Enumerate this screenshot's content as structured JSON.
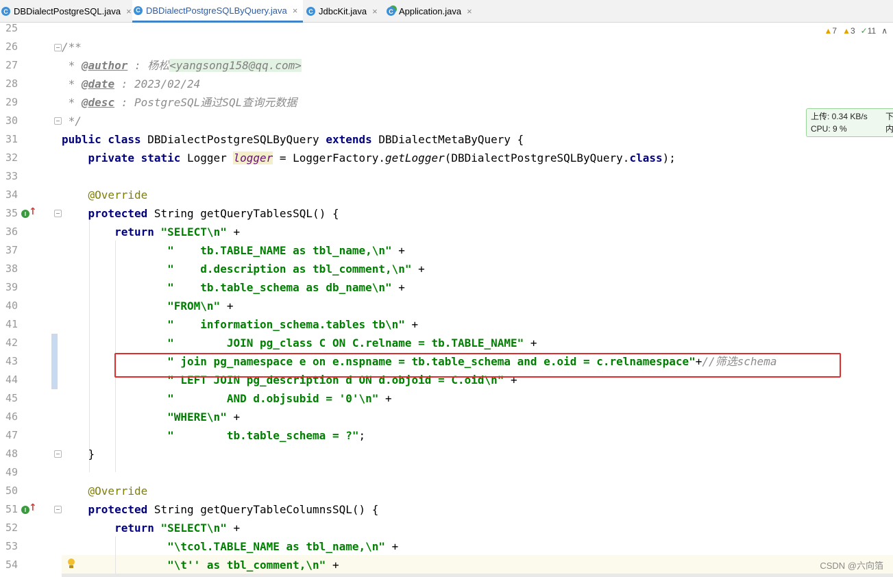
{
  "tabs": [
    {
      "name": "DBDialectPostgreSQL.java",
      "active": false,
      "icon": "class-icon",
      "close": "×"
    },
    {
      "name": "DBDialectPostgreSQLByQuery.java",
      "active": true,
      "icon": "class-icon",
      "close": "×"
    },
    {
      "name": "JdbcKit.java",
      "active": false,
      "icon": "class-icon",
      "close": "×"
    },
    {
      "name": "Application.java",
      "active": false,
      "icon": "runnable-class-icon",
      "close": "×"
    }
  ],
  "inspection": {
    "warnings": "7",
    "weak_warnings": "3",
    "ok": "11"
  },
  "net_widget": {
    "upload": "上传: 0.34 KB/s",
    "cpu": "CPU: 9 %",
    "download_clipped": "下",
    "memory_clipped": "内"
  },
  "line_numbers": [
    "25",
    "26",
    "27",
    "28",
    "29",
    "30",
    "31",
    "32",
    "33",
    "34",
    "35",
    "36",
    "37",
    "38",
    "39",
    "40",
    "41",
    "42",
    "43",
    "44",
    "45",
    "46",
    "47",
    "48",
    "49",
    "50",
    "51",
    "52",
    "53",
    "54"
  ],
  "code": {
    "l26": "/**",
    "l27_star": " * ",
    "l27_tag": "@author",
    "l27_sep": " : 杨松",
    "l27_mail": "<yangsong158@qq.com>",
    "l28_star": " * ",
    "l28_tag": "@date",
    "l28_val": " : 2023/02/24",
    "l29_star": " * ",
    "l29_tag": "@desc",
    "l29_val": " : PostgreSQL通过SQL查询元数据",
    "l30": " */",
    "l31_kw": "public class",
    "l31_a": " DBDialectPostgreSQLByQuery ",
    "l31_kw2": "extends",
    "l31_b": " DBDialectMetaByQuery {",
    "l32_kw": "    private static",
    "l32_a": " Logger ",
    "l32_fld": "logger",
    "l32_b": " = LoggerFactory.",
    "l32_mth": "getLogger",
    "l32_c": "(DBDialectPostgreSQLByQuery.",
    "l32_kw2": "class",
    "l32_d": ");",
    "l34": "    @Override",
    "l35_kw": "    protected",
    "l35_a": " String getQueryTablesSQL() {",
    "l36_kw": "        return",
    "l36_sp": " ",
    "l36_str": "\"SELECT\\n\"",
    "l36_op": " +",
    "l37_str": "                \"    tb.TABLE_NAME as tbl_name,\\n\"",
    "l37_op": " +",
    "l38_str": "                \"    d.description as tbl_comment,\\n\"",
    "l38_op": " +",
    "l39_str": "                \"    tb.table_schema as db_name\\n\"",
    "l39_op": " +",
    "l40_str": "                \"FROM\\n\"",
    "l40_op": " +",
    "l41_str": "                \"    information_schema.tables tb\\n\"",
    "l41_op": " +",
    "l42_str": "                \"        JOIN pg_class C ON C.relname = tb.TABLE_NAME\"",
    "l42_op": " +",
    "l43_str": "                \" join pg_namespace e on e.nspname = tb.table_schema and e.oid = c.relnamespace\"",
    "l43_op": "+",
    "l43_cmt": "//筛选schema",
    "l44_str": "                \" LEFT JOIN pg_description d ON d.objoid = C.oid\\n\"",
    "l44_op": " +",
    "l45_str": "                \"        AND d.objsubid = '0'\\n\"",
    "l45_op": " +",
    "l46_str": "                \"WHERE\\n\"",
    "l46_op": " +",
    "l47_str": "                \"        tb.table_schema = ?\"",
    "l47_op": ";",
    "l48": "    }",
    "l50": "    @Override",
    "l51_kw": "    protected",
    "l51_a": " String getQueryTableColumnsSQL() {",
    "l52_kw": "        return",
    "l52_sp": " ",
    "l52_str": "\"SELECT\\n\"",
    "l52_op": " +",
    "l53_str": "                \"\\tcol.TABLE_NAME as tbl_name,\\n\"",
    "l53_op": " +",
    "l54_str": "                \"\\t'' as tbl_comment,\\n\"",
    "l54_op": " +"
  },
  "watermark": "CSDN @六向箔",
  "colors": {
    "keyword": "#000080",
    "string": "#008000",
    "comment": "#8c8c8c",
    "annotation": "#808000",
    "highlight": "#e02c2c",
    "active_tab": "#4083c9"
  }
}
